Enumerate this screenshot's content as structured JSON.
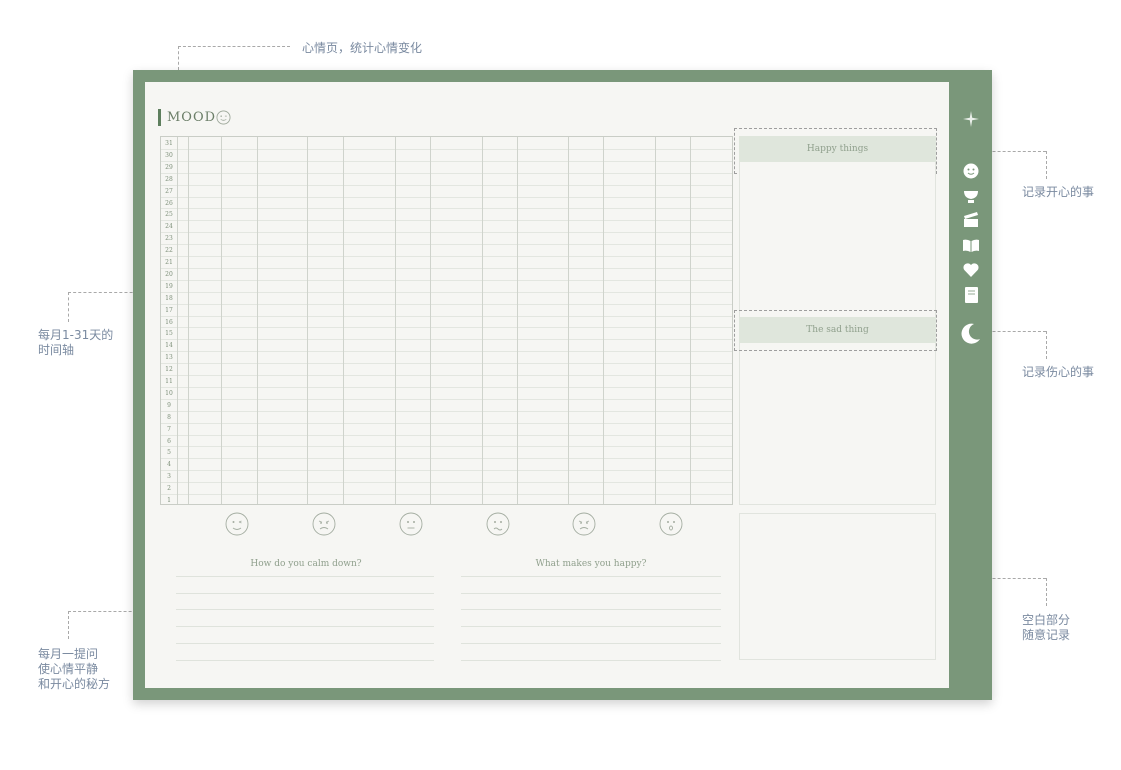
{
  "annotations": {
    "mood_page": "心情页，统计心情变化",
    "timeline_l1": "每月1-31天的",
    "timeline_l2": "时间轴",
    "happy": "记录开心的事",
    "sad": "记录伤心的事",
    "monthly_q_l1": "每月一提问",
    "monthly_q_l2": "使心情平静",
    "monthly_q_l3": "和开心的秘方",
    "blank_l1": "空白部分",
    "blank_l2": "随意记录"
  },
  "page": {
    "title": "MOOD",
    "days": [
      "31",
      "30",
      "29",
      "28",
      "27",
      "26",
      "25",
      "24",
      "23",
      "22",
      "21",
      "20",
      "19",
      "18",
      "17",
      "16",
      "15",
      "14",
      "13",
      "12",
      "11",
      "10",
      "9",
      "8",
      "7",
      "6",
      "5",
      "4",
      "3",
      "2",
      "1"
    ],
    "mood_faces": [
      "wink-face-icon",
      "sad-face-icon",
      "neutral-face-icon",
      "confused-face-icon",
      "angry-face-icon",
      "surprised-face-icon"
    ],
    "happy_things": "Happy things",
    "sad_thing": "The sad thing",
    "question_1": "How do you calm down?",
    "question_2": "What makes you happy?"
  },
  "sidebar": {
    "icons": [
      "sparkle-icon",
      "smiley-icon",
      "cup-icon",
      "clapperboard-icon",
      "book-icon",
      "heart-icon",
      "notebook-icon",
      "moon-icon"
    ]
  },
  "colors": {
    "frame": "#7a977a",
    "paper": "#f6f6f3",
    "header_fill": "#dfe6dc",
    "annotation_text": "#7a8aa0"
  }
}
